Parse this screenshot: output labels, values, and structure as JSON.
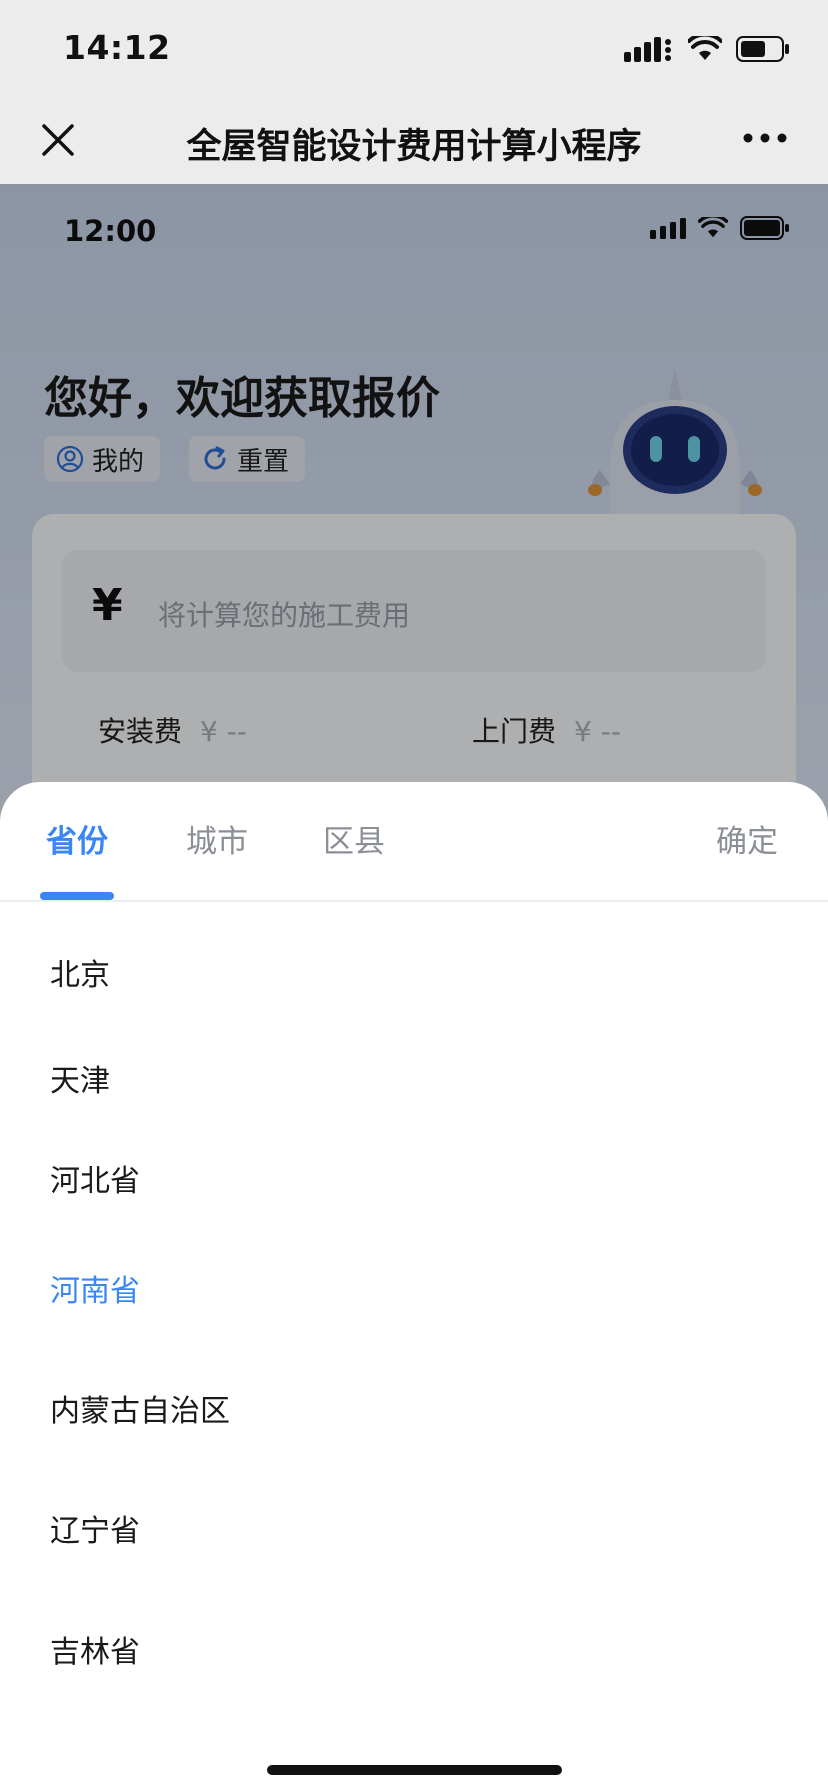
{
  "system_status": {
    "time": "14:12"
  },
  "navbar": {
    "title": "全屋智能设计费用计算小程序"
  },
  "inner_status": {
    "time": "12:00"
  },
  "page": {
    "greeting": "您好，欢迎获取报价",
    "mine_label": "我的",
    "reset_label": "重置",
    "currency_symbol": "¥",
    "cost_placeholder": "将计算您的施工费用",
    "install_fee_label": "安装费",
    "install_fee_value": "¥ --",
    "visit_fee_label": "上门费",
    "visit_fee_value": "¥ --"
  },
  "picker": {
    "tabs": [
      {
        "label": "省份",
        "active": true
      },
      {
        "label": "城市",
        "active": false
      },
      {
        "label": "区县",
        "active": false
      }
    ],
    "confirm_label": "确定",
    "provinces": [
      {
        "label": "北京",
        "selected": false
      },
      {
        "label": "天津",
        "selected": false
      },
      {
        "label": "河北省",
        "selected": false
      },
      {
        "label": "河南省",
        "selected": true
      },
      {
        "label": "内蒙古自治区",
        "selected": false
      },
      {
        "label": "辽宁省",
        "selected": false
      },
      {
        "label": "吉林省",
        "selected": false
      }
    ]
  },
  "colors": {
    "accent": "#3a86f5",
    "chrome": "#ececec",
    "muted": "#8b8f96"
  }
}
